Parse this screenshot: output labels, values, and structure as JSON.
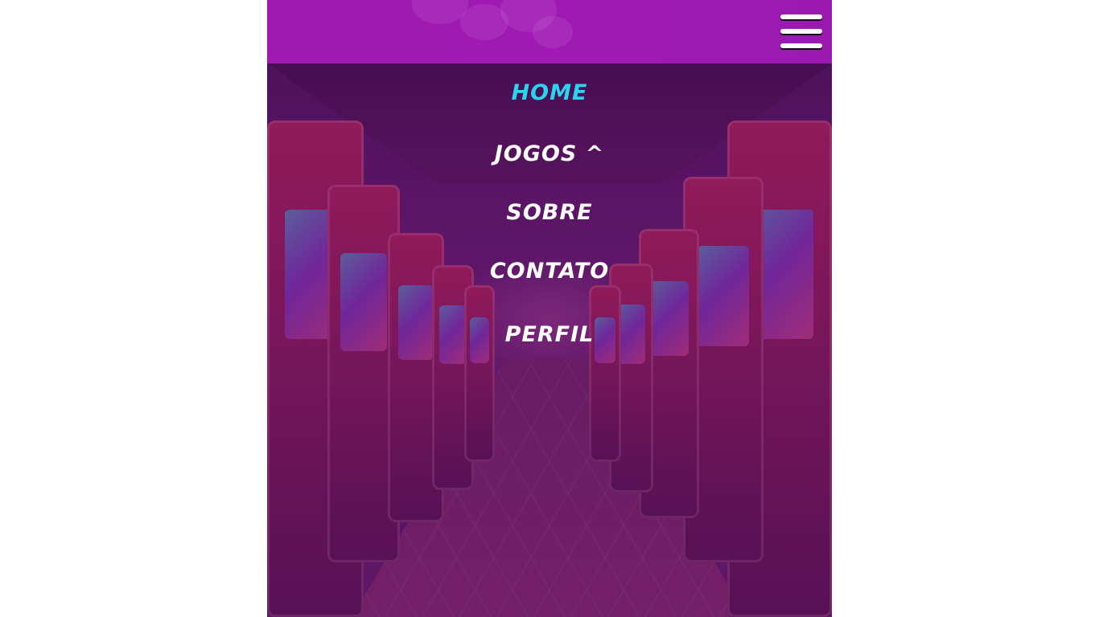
{
  "app": {
    "colors": {
      "topbar": "#a01ab0",
      "active_link": "#2ad4ef",
      "link": "#ffffff",
      "overlay": "#550a5a"
    },
    "menu_icon": "hamburger-icon"
  },
  "menu": {
    "items": [
      {
        "label": "HOME",
        "active": true
      },
      {
        "label": "JOGOS ^",
        "active": false
      },
      {
        "label": "SOBRE",
        "active": false
      },
      {
        "label": "CONTATO",
        "active": false
      },
      {
        "label": "PERFIL",
        "active": false
      }
    ]
  }
}
